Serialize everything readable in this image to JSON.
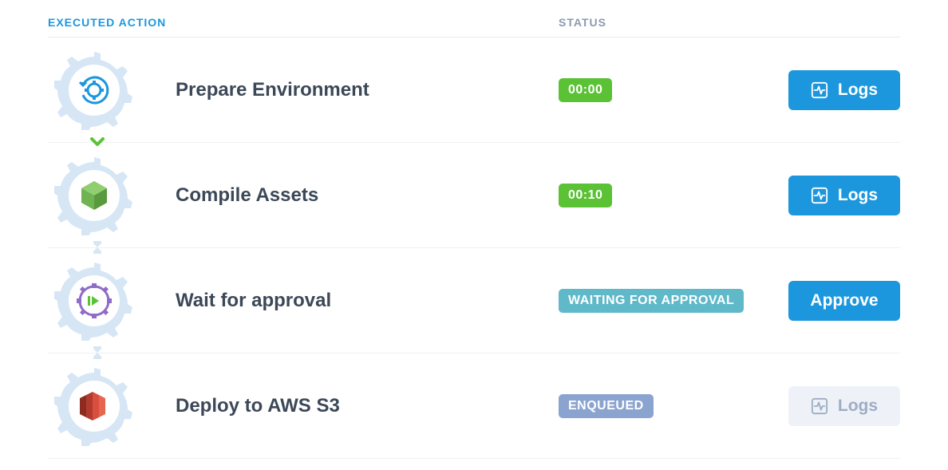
{
  "headers": {
    "action": "EXECUTED ACTION",
    "status": "STATUS"
  },
  "rows": [
    {
      "name": "Prepare Environment",
      "icon": "gear-refresh",
      "status": {
        "text": "00:00",
        "style": "green"
      },
      "button": {
        "label": "Logs",
        "style": "primary",
        "icon": "activity"
      },
      "connector": "chevron"
    },
    {
      "name": "Compile Assets",
      "icon": "box-green",
      "status": {
        "text": "00:10",
        "style": "green"
      },
      "button": {
        "label": "Logs",
        "style": "primary",
        "icon": "activity"
      },
      "connector": "hourglass"
    },
    {
      "name": "Wait for approval",
      "icon": "play-gear",
      "status": {
        "text": "WAITING FOR APPROVAL",
        "style": "teal"
      },
      "button": {
        "label": "Approve",
        "style": "primary",
        "icon": null
      },
      "connector": "hourglass"
    },
    {
      "name": "Deploy to AWS S3",
      "icon": "aws",
      "status": {
        "text": "ENQUEUED",
        "style": "blue"
      },
      "button": {
        "label": "Logs",
        "style": "disabled",
        "icon": "activity"
      },
      "connector": null
    }
  ]
}
